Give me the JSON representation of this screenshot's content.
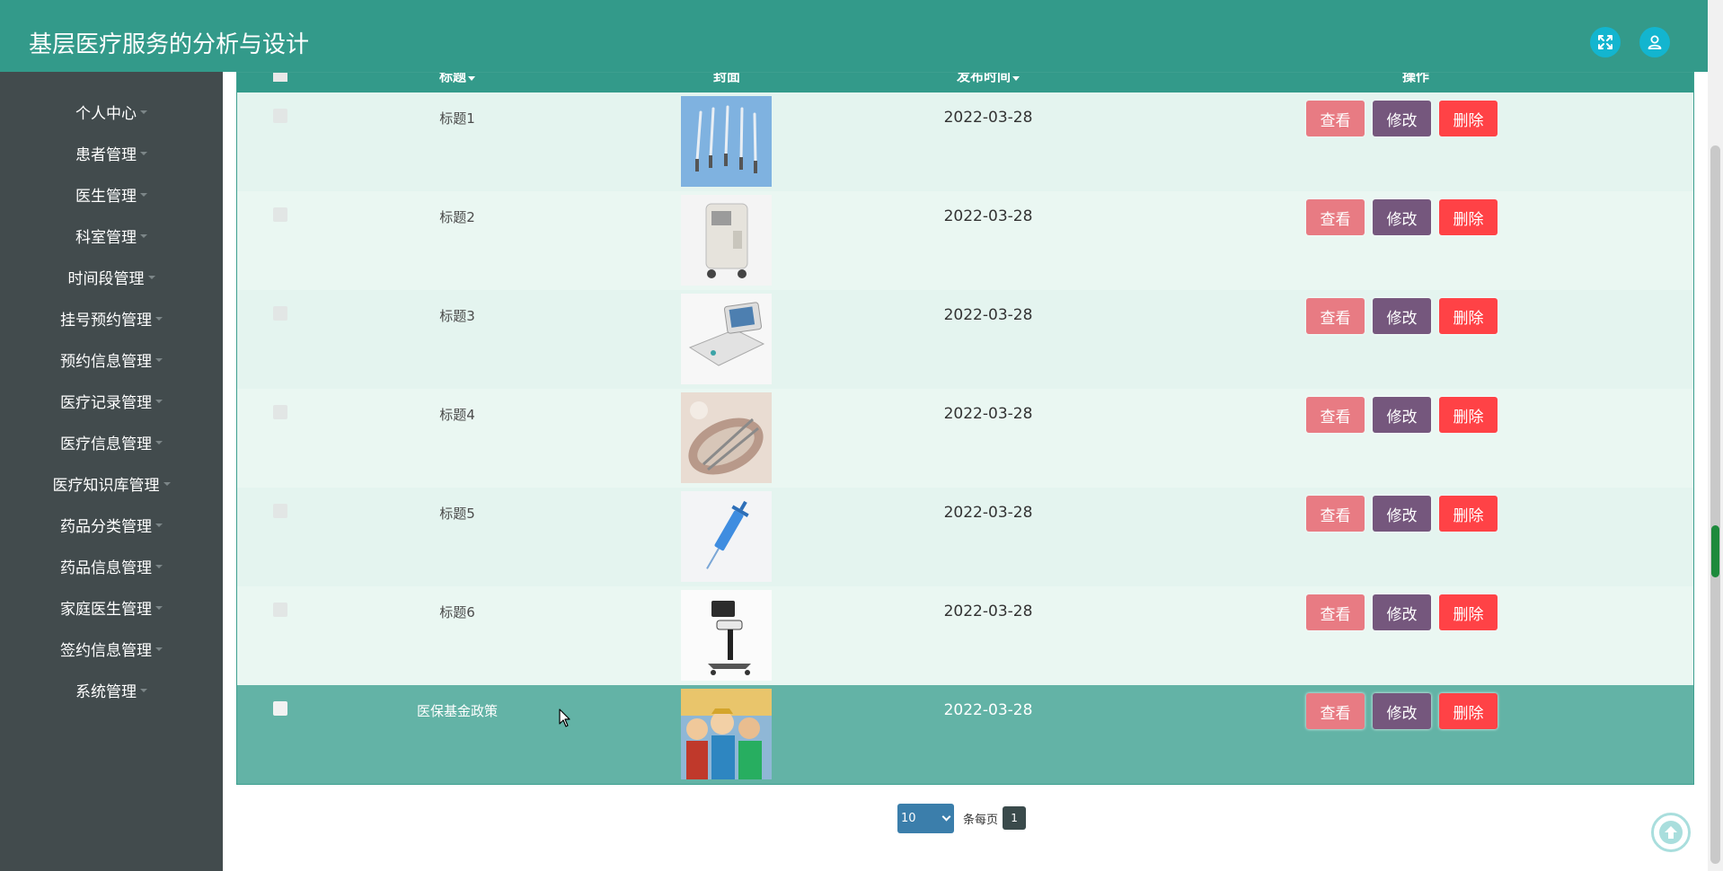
{
  "app": {
    "title": "基层医疗服务的分析与设计"
  },
  "header": {
    "icons": {
      "fullscreen": "fullscreen-icon",
      "user": "user-icon"
    },
    "colors": {
      "background": "#339a8a",
      "icon_bg": "#13b5cf"
    }
  },
  "sidebar": {
    "items": [
      {
        "label": "个人中心"
      },
      {
        "label": "患者管理"
      },
      {
        "label": "医生管理"
      },
      {
        "label": "科室管理"
      },
      {
        "label": "时间段管理"
      },
      {
        "label": "挂号预约管理"
      },
      {
        "label": "预约信息管理"
      },
      {
        "label": "医疗记录管理"
      },
      {
        "label": "医疗信息管理"
      },
      {
        "label": "医疗知识库管理"
      },
      {
        "label": "药品分类管理"
      },
      {
        "label": "药品信息管理"
      },
      {
        "label": "家庭医生管理"
      },
      {
        "label": "签约信息管理"
      },
      {
        "label": "系统管理"
      }
    ]
  },
  "table": {
    "columns": {
      "title": "标题",
      "cover": "封面",
      "publish_time": "发布时间",
      "actions": "操作"
    },
    "rows": [
      {
        "title": "标题1",
        "date": "2022-03-28",
        "cover": "scalpel-set-image"
      },
      {
        "title": "标题2",
        "date": "2022-03-28",
        "cover": "medical-cart-device-image"
      },
      {
        "title": "标题3",
        "date": "2022-03-28",
        "cover": "medical-monitor-device-image"
      },
      {
        "title": "标题4",
        "date": "2022-03-28",
        "cover": "medical-instruments-image"
      },
      {
        "title": "标题5",
        "date": "2022-03-28",
        "cover": "syringe-image"
      },
      {
        "title": "标题6",
        "date": "2022-03-28",
        "cover": "ultrasound-cart-image"
      },
      {
        "title": "医保基金政策",
        "date": "2022-03-28",
        "cover": "anime-poster-image",
        "highlighted": true
      }
    ],
    "actions": {
      "view": "查看",
      "edit": "修改",
      "delete": "删除"
    },
    "colors": {
      "view": "#e87b83",
      "edit": "#75577d",
      "delete": "#ff4246",
      "highlight_row": "#63b3a6"
    }
  },
  "pagination": {
    "page_size": "10",
    "per_page_label": "条每页",
    "current_page": "1"
  }
}
